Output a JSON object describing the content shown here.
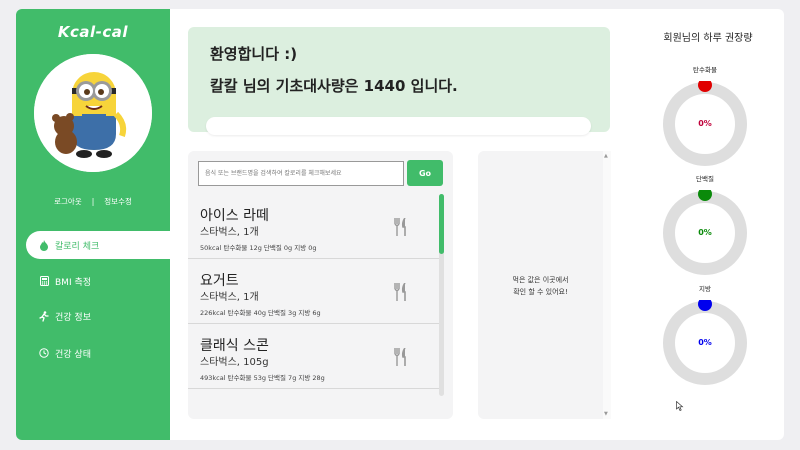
{
  "sidebar": {
    "logo": "Kcal-cal",
    "logout": "로그아웃",
    "separator": "|",
    "edit_info": "정보수정",
    "items": [
      {
        "label": "칼로리 체크",
        "icon": "fire-icon",
        "active": true
      },
      {
        "label": "BMI 측정",
        "icon": "calculator-icon",
        "active": false
      },
      {
        "label": "건강 정보",
        "icon": "running-icon",
        "active": false
      },
      {
        "label": "건강 상태",
        "icon": "clock-icon",
        "active": false
      }
    ]
  },
  "welcome": {
    "greeting": "환영합니다 :)",
    "bmr_text": "칼칼 님의 기초대사량은 1440 입니다."
  },
  "search": {
    "placeholder": "음식 또는 브랜드명을 검색하여 칼로리를 체크해보세요",
    "button": "Go"
  },
  "foods": [
    {
      "name": "아이스 라떼",
      "brand_qty": "스타벅스, 1개",
      "nutrition": "50kcal  탄수화물 12g  단백질 0g  지방 0g"
    },
    {
      "name": "요거트",
      "brand_qty": "스타벅스, 1개",
      "nutrition": "226kcal  탄수화물 40g  단백질 3g  지방 6g"
    },
    {
      "name": "클래식 스콘",
      "brand_qty": "스타벅스, 105g",
      "nutrition": "493kcal  탄수화물 53g  단백질 7g  지방 28g"
    }
  ],
  "eaten": {
    "line1": "먹은 값은 이곳에서",
    "line2": "확인 할 수 있어요!"
  },
  "recommend": {
    "title": "회원님의 하루 권장량",
    "nutrients": [
      {
        "label": "탄수화물",
        "value": "0%",
        "color": "#e00000"
      },
      {
        "label": "단백질",
        "value": "0%",
        "color": "#0a8a0a"
      },
      {
        "label": "지방",
        "value": "0%",
        "color": "#0000ee"
      }
    ]
  },
  "colors": {
    "accent": "#41bc6a",
    "welcome_bg": "#dcefdf"
  }
}
